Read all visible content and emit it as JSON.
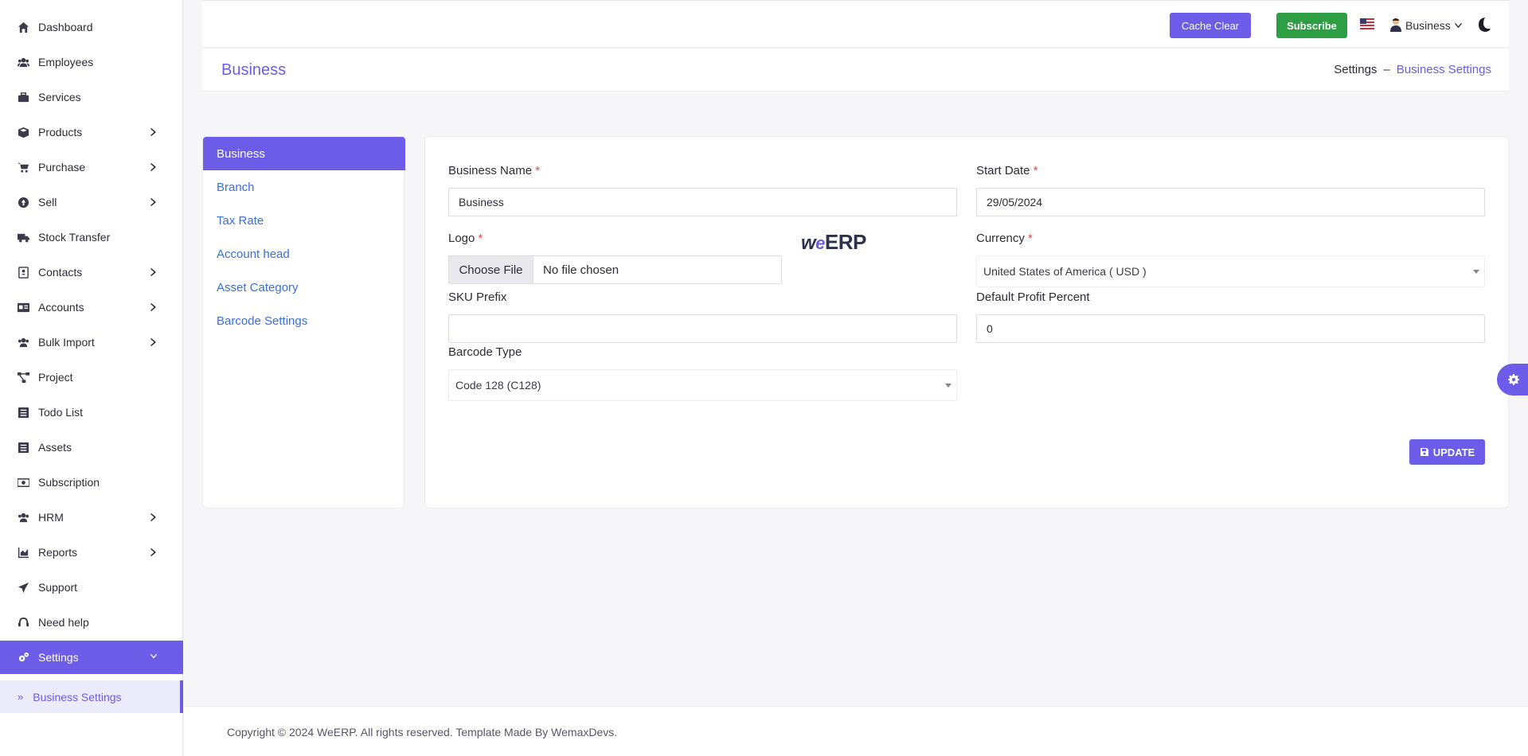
{
  "sidebar": {
    "items": [
      {
        "label": "Dashboard",
        "icon": "home-icon",
        "has_children": false
      },
      {
        "label": "Employees",
        "icon": "users-icon",
        "has_children": false
      },
      {
        "label": "Services",
        "icon": "briefcase-icon",
        "has_children": false
      },
      {
        "label": "Products",
        "icon": "box-icon",
        "has_children": true
      },
      {
        "label": "Purchase",
        "icon": "cart-icon",
        "has_children": true
      },
      {
        "label": "Sell",
        "icon": "arrow-up-circle-icon",
        "has_children": true
      },
      {
        "label": "Stock Transfer",
        "icon": "truck-icon",
        "has_children": false
      },
      {
        "label": "Contacts",
        "icon": "address-book-icon",
        "has_children": true
      },
      {
        "label": "Accounts",
        "icon": "id-card-icon",
        "has_children": true
      },
      {
        "label": "Bulk Import",
        "icon": "users-icon",
        "has_children": true
      },
      {
        "label": "Project",
        "icon": "project-diagram-icon",
        "has_children": false
      },
      {
        "label": "Todo List",
        "icon": "list-icon",
        "has_children": false
      },
      {
        "label": "Assets",
        "icon": "list-icon",
        "has_children": false
      },
      {
        "label": "Subscription",
        "icon": "money-bill-icon",
        "has_children": false
      },
      {
        "label": "HRM",
        "icon": "users-icon",
        "has_children": true
      },
      {
        "label": "Reports",
        "icon": "chart-area-icon",
        "has_children": true
      },
      {
        "label": "Support",
        "icon": "paper-plane-icon",
        "has_children": false
      },
      {
        "label": "Need help",
        "icon": "headset-icon",
        "has_children": false
      },
      {
        "label": "Settings",
        "icon": "cogs-icon",
        "has_children": true,
        "expanded": true
      }
    ],
    "sub_item": {
      "label": "Business Settings",
      "icon": "double-chevron-right-icon"
    }
  },
  "topbar": {
    "cache_clear_label": "Cache Clear",
    "subscribe_label": "Subscribe",
    "language_icon": "us-flag-icon",
    "user_label": "Business",
    "theme_icon": "moon-icon"
  },
  "page": {
    "title": "Business",
    "breadcrumb": {
      "parent": "Settings",
      "separator": "–",
      "current": "Business Settings"
    }
  },
  "settings_menu": [
    "Business",
    "Branch",
    "Tax Rate",
    "Account head",
    "Asset Category",
    "Barcode Settings"
  ],
  "form": {
    "business_name_label": "Business Name",
    "business_name_value": "Business",
    "start_date_label": "Start Date",
    "start_date_value": "29/05/2024",
    "logo_label": "Logo",
    "choose_file_label": "Choose File",
    "no_file_label": "No file chosen",
    "logo_text_w": "w",
    "logo_text_e": "e",
    "logo_text_erp": "ERP",
    "currency_label": "Currency",
    "currency_value": "United States of America ( USD )",
    "sku_prefix_label": "SKU Prefix",
    "sku_prefix_value": "",
    "default_profit_label": "Default Profit Percent",
    "default_profit_value": "0",
    "barcode_type_label": "Barcode Type",
    "barcode_type_value": "Code 128 (C128)",
    "required_mark": "*",
    "update_label": "UPDATE"
  },
  "footer": {
    "text": "Copyright © 2024 WeERP. All rights reserved. Template Made By WemaxDevs."
  },
  "colors": {
    "accent": "#6c5ce7",
    "success": "#2e9e44",
    "link": "#3b6fd8",
    "required": "#e34b4b"
  }
}
